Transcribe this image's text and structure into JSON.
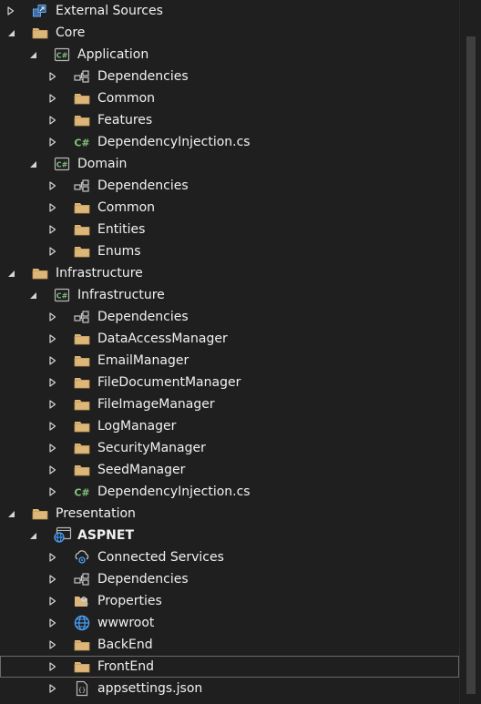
{
  "colors": {
    "background": "#1f1f1f",
    "folder": "#dcb67a",
    "folder_dark": "#c59a4f",
    "csharp_project": "#7fbf7f",
    "csharp_file": "#84c57c",
    "web": "#4aa3ff",
    "text": "#f1f1f1",
    "selection_border": "#6b6b6b"
  },
  "tree": [
    {
      "label": "External Sources",
      "icon": "external-sources-icon",
      "level": 0,
      "expander": "collapsed",
      "bold": false
    },
    {
      "label": "Core",
      "icon": "folder-icon",
      "level": 0,
      "expander": "expanded",
      "bold": false
    },
    {
      "label": "Application",
      "icon": "csharp-project-icon",
      "level": 1,
      "expander": "expanded",
      "bold": false
    },
    {
      "label": "Dependencies",
      "icon": "dependencies-icon",
      "level": 2,
      "expander": "collapsed",
      "bold": false
    },
    {
      "label": "Common",
      "icon": "folder-icon",
      "level": 2,
      "expander": "collapsed",
      "bold": false
    },
    {
      "label": "Features",
      "icon": "folder-icon",
      "level": 2,
      "expander": "collapsed",
      "bold": false
    },
    {
      "label": "DependencyInjection.cs",
      "icon": "csharp-file-icon",
      "level": 2,
      "expander": "collapsed",
      "bold": false
    },
    {
      "label": "Domain",
      "icon": "csharp-project-icon",
      "level": 1,
      "expander": "expanded",
      "bold": false
    },
    {
      "label": "Dependencies",
      "icon": "dependencies-icon",
      "level": 2,
      "expander": "collapsed",
      "bold": false
    },
    {
      "label": "Common",
      "icon": "folder-icon",
      "level": 2,
      "expander": "collapsed",
      "bold": false
    },
    {
      "label": "Entities",
      "icon": "folder-icon",
      "level": 2,
      "expander": "collapsed",
      "bold": false
    },
    {
      "label": "Enums",
      "icon": "folder-icon",
      "level": 2,
      "expander": "collapsed",
      "bold": false
    },
    {
      "label": "Infrastructure",
      "icon": "folder-icon",
      "level": 0,
      "expander": "expanded",
      "bold": false
    },
    {
      "label": "Infrastructure",
      "icon": "csharp-project-icon",
      "level": 1,
      "expander": "expanded",
      "bold": false
    },
    {
      "label": "Dependencies",
      "icon": "dependencies-icon",
      "level": 2,
      "expander": "collapsed",
      "bold": false
    },
    {
      "label": "DataAccessManager",
      "icon": "folder-icon",
      "level": 2,
      "expander": "collapsed",
      "bold": false
    },
    {
      "label": "EmailManager",
      "icon": "folder-icon",
      "level": 2,
      "expander": "collapsed",
      "bold": false
    },
    {
      "label": "FileDocumentManager",
      "icon": "folder-icon",
      "level": 2,
      "expander": "collapsed",
      "bold": false
    },
    {
      "label": "FileImageManager",
      "icon": "folder-icon",
      "level": 2,
      "expander": "collapsed",
      "bold": false
    },
    {
      "label": "LogManager",
      "icon": "folder-icon",
      "level": 2,
      "expander": "collapsed",
      "bold": false
    },
    {
      "label": "SecurityManager",
      "icon": "folder-icon",
      "level": 2,
      "expander": "collapsed",
      "bold": false
    },
    {
      "label": "SeedManager",
      "icon": "folder-icon",
      "level": 2,
      "expander": "collapsed",
      "bold": false
    },
    {
      "label": "DependencyInjection.cs",
      "icon": "csharp-file-icon",
      "level": 2,
      "expander": "collapsed",
      "bold": false
    },
    {
      "label": "Presentation",
      "icon": "folder-icon",
      "level": 0,
      "expander": "expanded",
      "bold": false
    },
    {
      "label": "ASPNET",
      "icon": "web-project-icon",
      "level": 1,
      "expander": "expanded",
      "bold": true
    },
    {
      "label": "Connected Services",
      "icon": "connected-services-icon",
      "level": 2,
      "expander": "collapsed",
      "bold": false
    },
    {
      "label": "Dependencies",
      "icon": "dependencies-icon",
      "level": 2,
      "expander": "collapsed",
      "bold": false
    },
    {
      "label": "Properties",
      "icon": "properties-icon",
      "level": 2,
      "expander": "collapsed",
      "bold": false
    },
    {
      "label": "wwwroot",
      "icon": "globe-icon",
      "level": 2,
      "expander": "collapsed",
      "bold": false
    },
    {
      "label": "BackEnd",
      "icon": "folder-icon",
      "level": 2,
      "expander": "collapsed",
      "bold": false
    },
    {
      "label": "FrontEnd",
      "icon": "folder-icon",
      "level": 2,
      "expander": "collapsed",
      "bold": false,
      "selected": true
    },
    {
      "label": "appsettings.json",
      "icon": "json-file-icon",
      "level": 2,
      "expander": "collapsed",
      "bold": false
    }
  ]
}
